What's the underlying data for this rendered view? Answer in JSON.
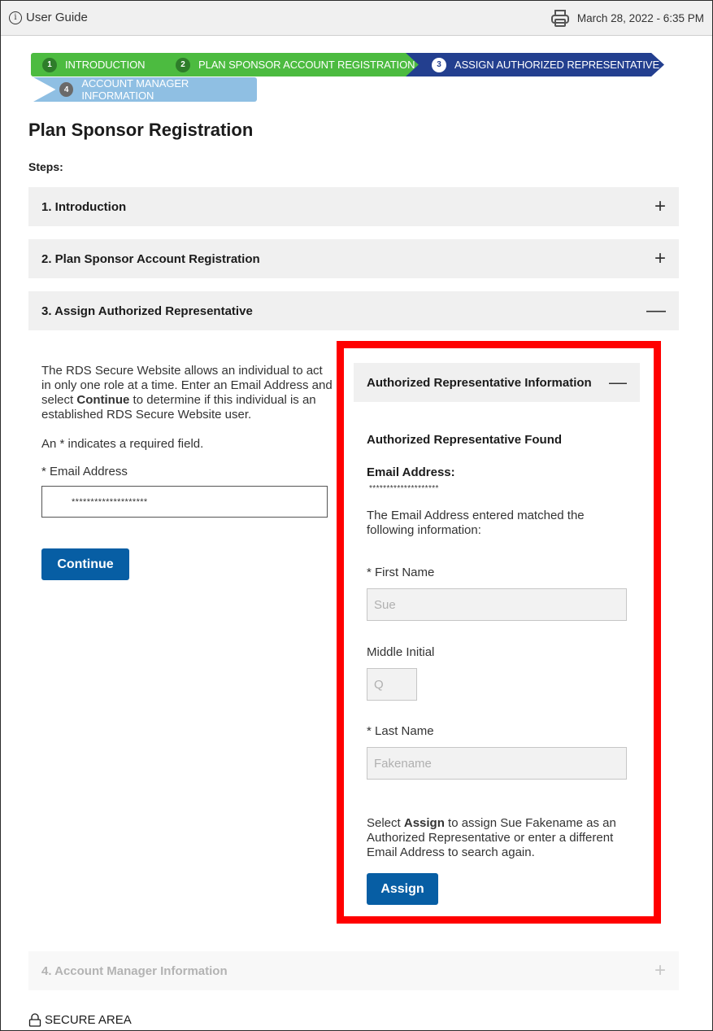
{
  "topbar": {
    "guide_label": "User Guide",
    "info_icon": "i",
    "date": "March 28, 2022 - 6:35 PM"
  },
  "stepper": [
    {
      "num": "1",
      "label": "INTRODUCTION",
      "state": "complete",
      "color": "#4cbb40"
    },
    {
      "num": "2",
      "label": "PLAN SPONSOR ACCOUNT REGISTRATION",
      "state": "complete",
      "color": "#4cbb40"
    },
    {
      "num": "3",
      "label": "ASSIGN AUTHORIZED REPRESENTATIVE",
      "state": "current",
      "color": "#233f8f"
    },
    {
      "num": "4",
      "label": "ACCOUNT MANAGER INFORMATION",
      "state": "upcoming",
      "color": "#8fbfe3"
    }
  ],
  "page": {
    "title": "Plan Sponsor Registration",
    "steps_label": "Steps:"
  },
  "accordion": [
    {
      "label": "1. Introduction",
      "sign": "+",
      "expanded": false
    },
    {
      "label": "2. Plan Sponsor Account Registration",
      "sign": "+",
      "expanded": false
    },
    {
      "label": "3. Assign Authorized Representative",
      "sign": "—",
      "expanded": true
    },
    {
      "label": "4. Account Manager Information",
      "sign": "+",
      "expanded": false,
      "disabled": true
    }
  ],
  "left": {
    "intro_pre": "The RDS Secure Website allows an individual to act in only one role at a time. Enter an Email Address and select ",
    "intro_bold": "Continue",
    "intro_post": " to determine if this individual is an established RDS Secure Website user.",
    "required_note": "An * indicates a required field.",
    "email_label": "* Email Address",
    "email_value": "********************",
    "continue_label": "Continue"
  },
  "rep_panel": {
    "header": "Authorized Representative Information",
    "header_sign": "—",
    "found_title": "Authorized Representative Found",
    "email_label": "Email Address:",
    "email_value": "********************",
    "matched_text": "The Email Address entered matched the following information:",
    "first_name_label": "* First Name",
    "first_name_value": "Sue",
    "middle_initial_label": "Middle Initial",
    "middle_initial_value": "Q",
    "last_name_label": "* Last Name",
    "last_name_value": "Fakename",
    "select_pre": "Select ",
    "select_bold": "Assign",
    "select_post": " to assign Sue Fakename as an Authorized Representative or enter a different Email Address to search again.",
    "assign_label": "Assign",
    "highlight_color": "#ff0000"
  },
  "footer": {
    "secure_label": "SECURE AREA"
  },
  "colors": {
    "primary_button": "#075ea4",
    "step_complete": "#4cbb40",
    "step_current": "#233f8f",
    "step_upcoming": "#8fbfe3"
  }
}
